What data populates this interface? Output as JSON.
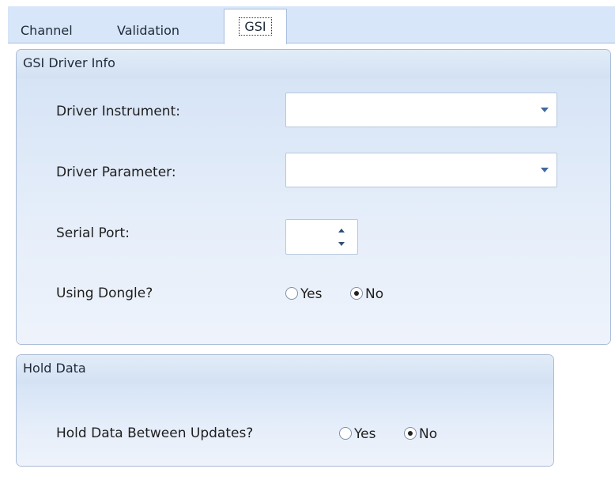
{
  "tabs": [
    {
      "label": "Channel"
    },
    {
      "label": "Validation"
    },
    {
      "label": "GSI"
    }
  ],
  "gsi_panel": {
    "title": "GSI Driver Info",
    "driver_instrument_label": "Driver Instrument:",
    "driver_instrument_value": "",
    "driver_parameter_label": "Driver Parameter:",
    "driver_parameter_value": "",
    "serial_port_label": "Serial Port:",
    "serial_port_value": "",
    "dongle_label": "Using Dongle?",
    "dongle_yes": "Yes",
    "dongle_no": "No",
    "dongle_selected": "No"
  },
  "hold_panel": {
    "title": "Hold Data",
    "hold_label": "Hold Data Between Updates?",
    "hold_yes": "Yes",
    "hold_no": "No",
    "hold_selected": "No"
  },
  "colors": {
    "tabstrip": "#d7e6f8",
    "panel_border": "#a9bcd6",
    "arrow": "#3e6aa3"
  }
}
